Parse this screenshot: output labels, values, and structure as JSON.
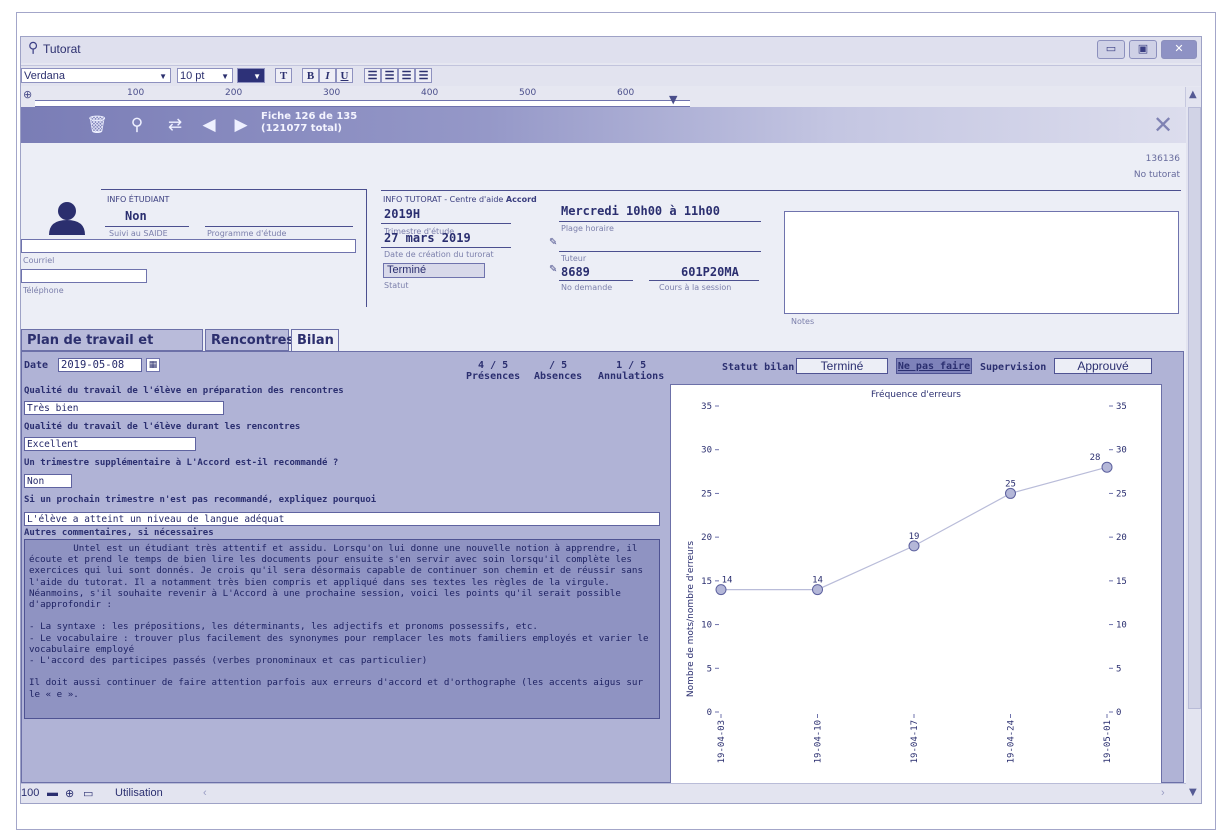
{
  "window": {
    "title": "Tutorat"
  },
  "format_bar": {
    "font": "Verdana",
    "size": "10 pt",
    "text_button": "T",
    "bold": "B",
    "italic": "I",
    "underline": "U"
  },
  "ruler": {
    "marks": [
      "100",
      "200",
      "300",
      "400",
      "500",
      "600"
    ]
  },
  "banner": {
    "fiche_line1": "Fiche 126 de 135",
    "fiche_line2": "(121077 total)"
  },
  "record": {
    "id": "136136",
    "id_label": "No tutorat"
  },
  "student": {
    "section_title": "INFO ÉTUDIANT",
    "saide_value": "Non",
    "saide_label": "Suivi au SAIDE",
    "program_label": "Programme d'étude",
    "email_label": "Courriel",
    "phone_label": "Téléphone"
  },
  "tutoring": {
    "section_title": "INFO TUTORAT - Centre d'aide",
    "section_title_bold": "Accord",
    "term_value": "2019H",
    "term_label": "Trimestre d'étude",
    "schedule_value": "Mercredi 10h00 à 11h00",
    "schedule_label": "Plage horaire",
    "created_value": "27 mars 2019",
    "created_label": "Date de création du turorat",
    "tutor_label": "Tuteur",
    "status_value": "Terminé",
    "status_label": "Statut",
    "request_value": "8689",
    "request_label": "No demande",
    "course_value": "601P20MA",
    "course_label": "Cours à la session",
    "notes_label": "Notes"
  },
  "tabs": [
    {
      "label": "Plan de travail et Notes"
    },
    {
      "label": "Rencontres"
    },
    {
      "label": "Bilan"
    }
  ],
  "bilan": {
    "date_label": "Date",
    "date_value": "2019-05-08",
    "presences_value": "4 / 5",
    "presences_label": "Présences",
    "absences_value": "/ 5",
    "absences_label": "Absences",
    "annulations_value": "1 / 5",
    "annulations_label": "Annulations",
    "statut_bilan_label": "Statut bilan",
    "statut_bilan_value": "Terminé",
    "ne_pas_faire": "Ne pas faire",
    "supervision_label": "Supervision",
    "supervision_value": "Approuvé",
    "q1_label": "Qualité du travail de l'élève en préparation des rencontres",
    "q1_value": "Très bien",
    "q2_label": "Qualité du travail de l'élève durant les rencontres",
    "q2_value": "Excellent",
    "q3_label": "Un trimestre supplémentaire à L'Accord est-il recommandé ?",
    "q3_value": "Non",
    "q4_label": "Si un prochain trimestre n'est pas recommandé, expliquez pourquoi",
    "q4_value": "L'élève a atteint un niveau de langue adéquat",
    "q5_label": "Autres commentaires, si nécessaires",
    "comments": "        Untel est un étudiant très attentif et assidu. Lorsqu'on lui donne une nouvelle notion à apprendre, il écoute et prend le temps de bien lire les documents pour ensuite s'en servir avec soin lorsqu'il complète les exercices qui lui sont donnés. Je crois qu'il sera désormais capable de continuer son chemin et de réussir sans l'aide du tutorat. Il a notamment très bien compris et appliqué dans ses textes les règles de la virgule. Néanmoins, s'il souhaite revenir à L'Accord à une prochaine session, voici les points qu'il serait possible d'approfondir :\n\n- La syntaxe : les prépositions, les déterminants, les adjectifs et pronoms possessifs, etc.\n- Le vocabulaire : trouver plus facilement des synonymes pour remplacer les mots familiers employés et varier le vocabulaire employé\n- L'accord des participes passés (verbes pronominaux et cas particulier)\n\nIl doit aussi continuer de faire attention parfois aux erreurs d'accord et d'orthographe (les accents aigus sur le « e »."
  },
  "chart_data": {
    "type": "line",
    "title": "Fréquence d'erreurs",
    "ylabel": "Nombre de mots/nombre d'erreurs",
    "xlabel": "",
    "x": [
      "19-04-03",
      "19-04-10",
      "19-04-17",
      "19-04-24",
      "19-05-01"
    ],
    "values": [
      14,
      14,
      19,
      25,
      28
    ],
    "ylim": [
      0,
      35
    ],
    "yticks": [
      0,
      5,
      10,
      15,
      20,
      25,
      30,
      35
    ],
    "grid": false,
    "color": "#b9bcd9"
  },
  "status_bar": {
    "zoom": "100",
    "mode": "Utilisation"
  }
}
